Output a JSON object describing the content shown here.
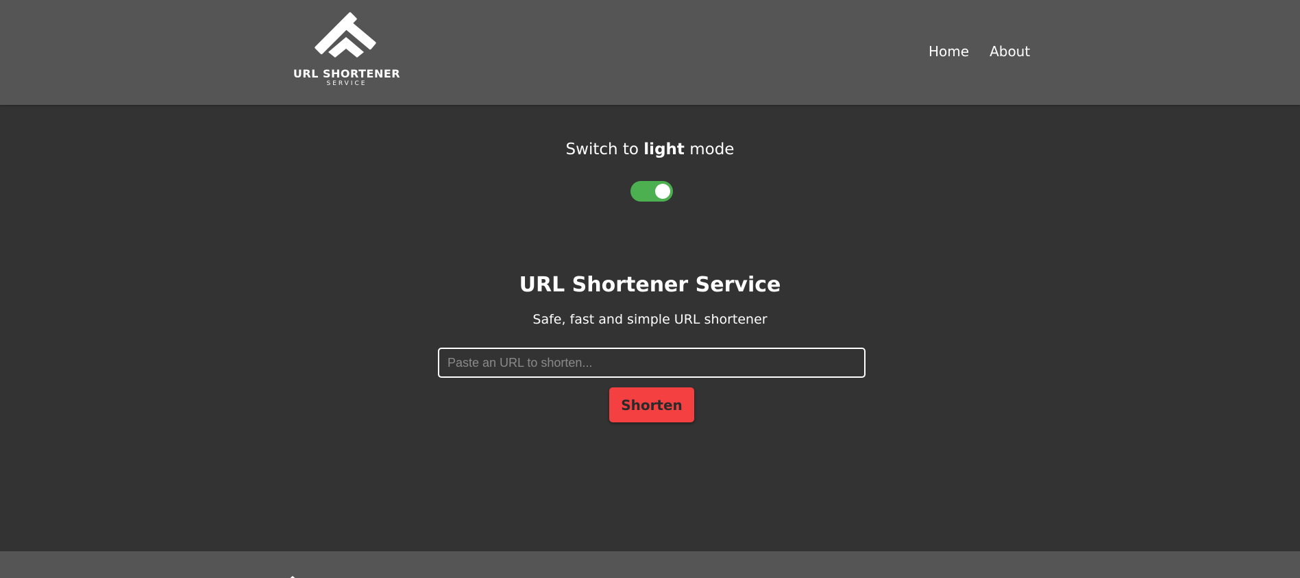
{
  "header": {
    "logo": {
      "title": "URL SHORTENER",
      "subtitle": "SERVICE",
      "icon": "logo-chevron-mark"
    },
    "nav": [
      {
        "label": "Home"
      },
      {
        "label": "About"
      }
    ]
  },
  "theme_switch": {
    "prefix": "Switch to ",
    "mode": "light",
    "suffix": " mode",
    "toggle_on": true,
    "toggle_color": "#4caf50"
  },
  "main": {
    "title": "URL Shortener Service",
    "subtitle": "Safe, fast and simple URL shortener",
    "input": {
      "placeholder": "Paste an URL to shorten...",
      "value": ""
    },
    "shorten_button": "Shorten",
    "button_color": "#f44040"
  },
  "colors": {
    "header_bg": "#555555",
    "page_bg": "#333333",
    "footer_bg": "#555555"
  }
}
